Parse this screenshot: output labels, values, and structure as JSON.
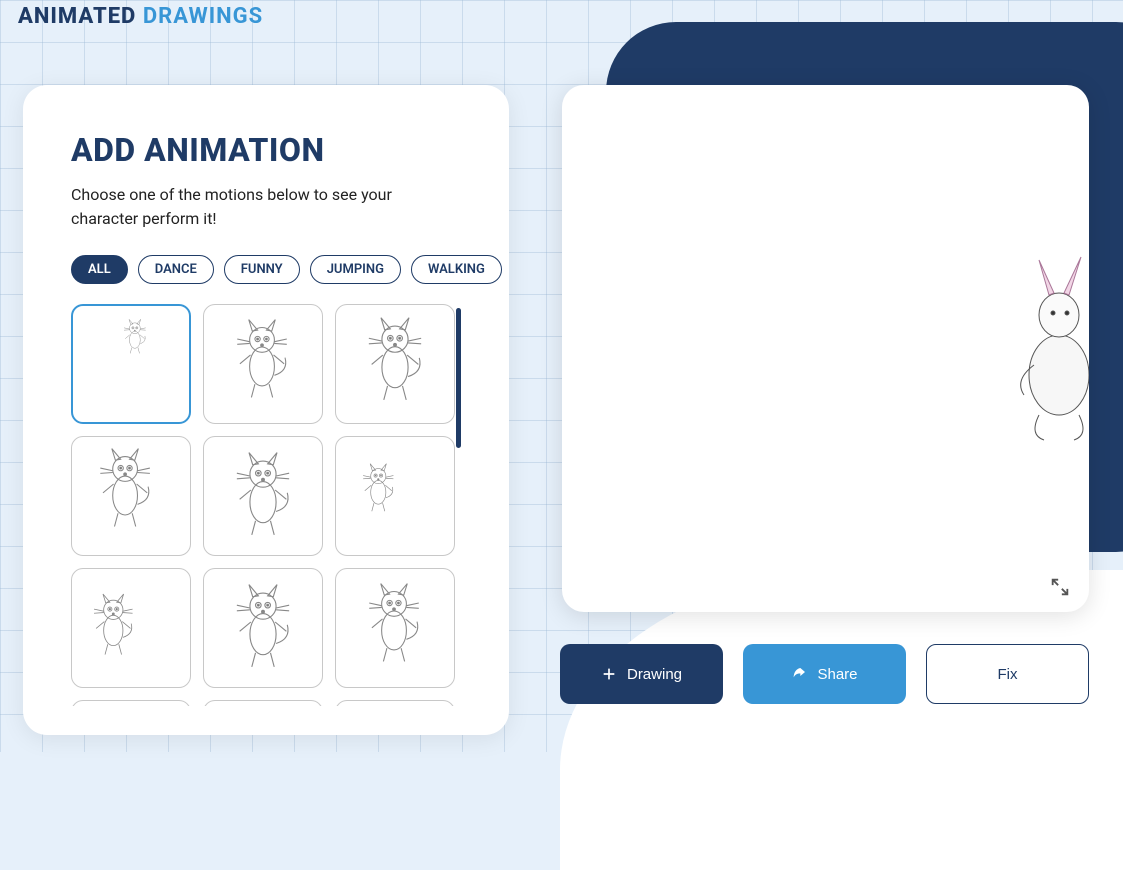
{
  "logo": {
    "word1": "ANIMATED",
    "word2": "DRAWINGS"
  },
  "panel": {
    "title": "ADD ANIMATION",
    "subtitle": "Choose one of the motions below to see your character perform it!"
  },
  "tabs": {
    "all": "ALL",
    "dance": "DANCE",
    "funny": "FUNNY",
    "jumping": "JUMPING",
    "walking": "WALKING",
    "active": "all"
  },
  "animations": {
    "selected_index": 0,
    "items": [
      {
        "name": "anim-1"
      },
      {
        "name": "anim-2"
      },
      {
        "name": "anim-3"
      },
      {
        "name": "anim-4"
      },
      {
        "name": "anim-5"
      },
      {
        "name": "anim-6"
      },
      {
        "name": "anim-7"
      },
      {
        "name": "anim-8"
      },
      {
        "name": "anim-9"
      },
      {
        "name": "anim-10"
      },
      {
        "name": "anim-11"
      },
      {
        "name": "anim-12"
      }
    ]
  },
  "buttons": {
    "drawing": "Drawing",
    "share": "Share",
    "fix": "Fix"
  },
  "icons": {
    "plus": "plus-icon",
    "share_arrow": "share-icon",
    "expand": "expand-icon"
  }
}
